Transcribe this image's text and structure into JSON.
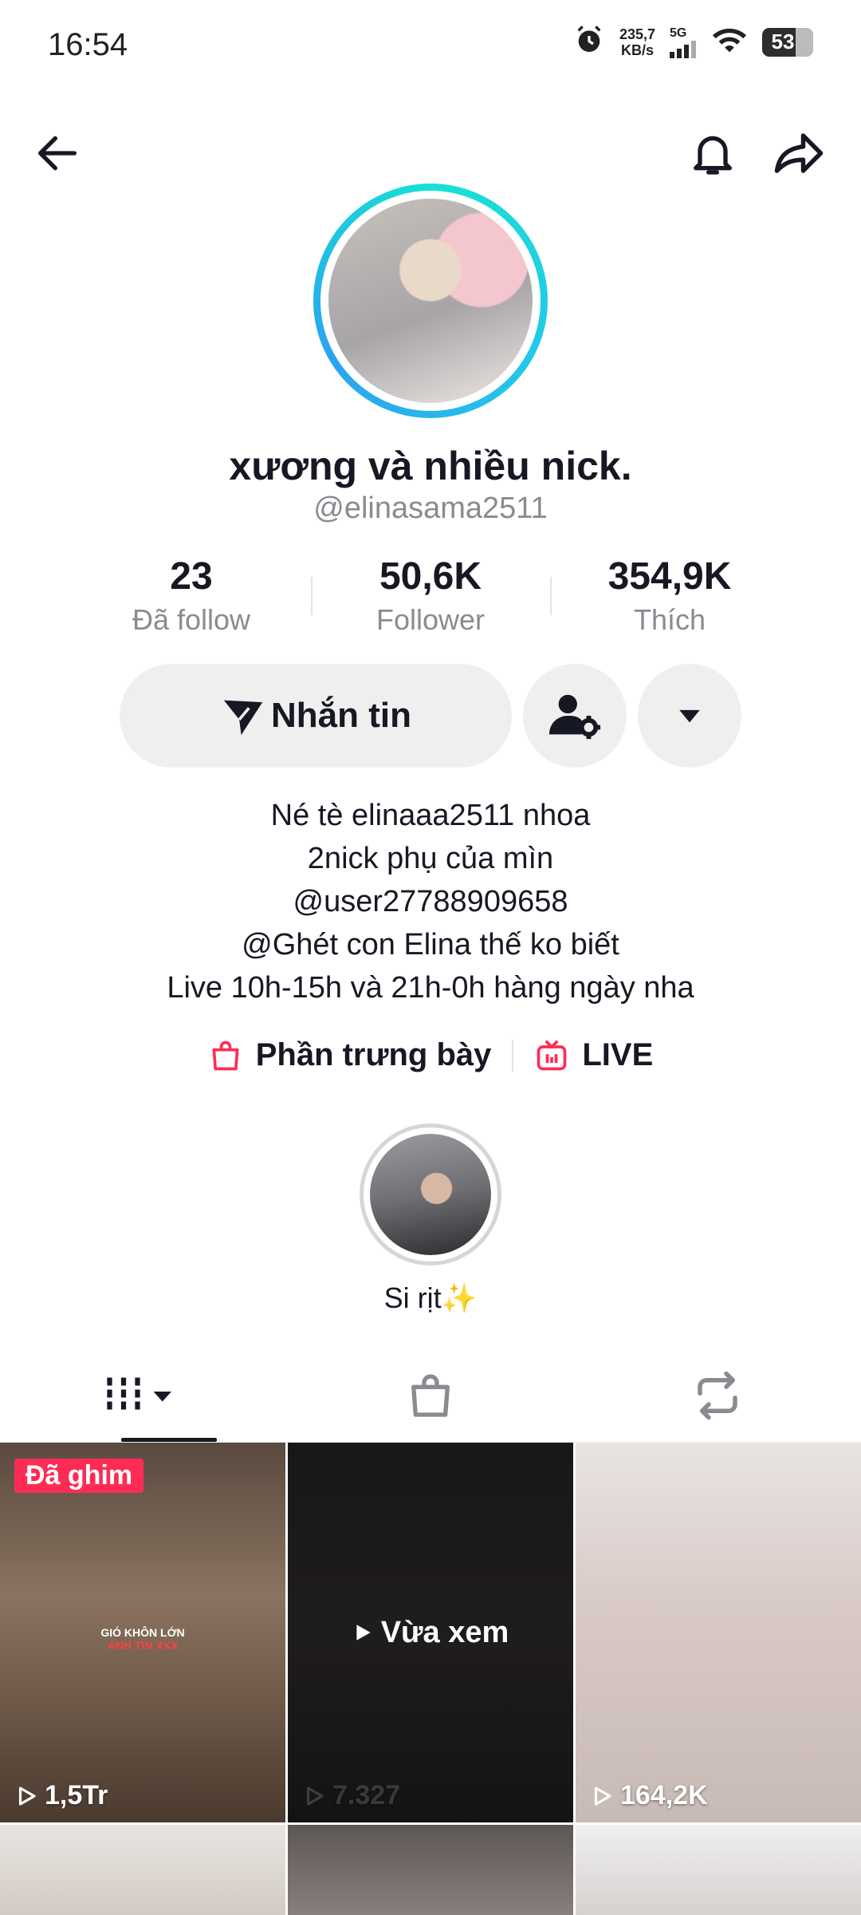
{
  "status_bar": {
    "time": "16:54",
    "speed_value": "235,7",
    "speed_unit": "KB/s",
    "network": "5G",
    "battery": "53"
  },
  "profile": {
    "display_name": "xương và nhiều nick.",
    "handle": "@elinasama2511",
    "stats": [
      {
        "value": "23",
        "label": "Đã follow"
      },
      {
        "value": "50,6K",
        "label": "Follower"
      },
      {
        "value": "354,9K",
        "label": "Thích"
      }
    ],
    "message_button": "Nhắn tin",
    "bio": [
      "Né tè elinaaa2511 nhoa",
      "2nick phụ của mìn",
      "@user27788909658",
      "@Ghét con Elina thế ko biết",
      "Live 10h-15h và 21h-0h hàng ngày nha"
    ],
    "links": {
      "showcase": "Phần trưng bày",
      "live": "LIVE"
    },
    "highlight_label": "Si rịt✨"
  },
  "videos": [
    {
      "badge": "Đã ghim",
      "views": "1,5Tr",
      "overlay_title": "GIÓ KHÔN LỚN",
      "overlay_sub": "ANH TIN XXX"
    },
    {
      "watched_label": "Vừa xem",
      "views": "7.327"
    },
    {
      "views": "164,2K"
    }
  ],
  "colors": {
    "accent": "#fe2c55",
    "ring_start": "#18e1d4",
    "ring_end": "#2ba3f0"
  }
}
